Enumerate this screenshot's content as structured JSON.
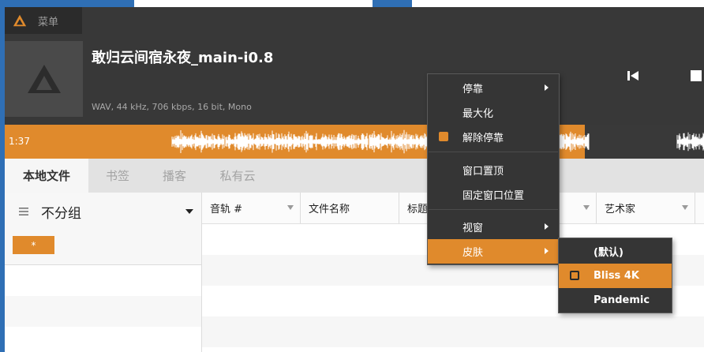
{
  "app": {
    "menu_label": "菜单",
    "track_title": "敢归云间宿永夜_main-i0.8",
    "track_info": "WAV, 44 kHz, 706 kbps, 16 bit, Mono",
    "elapsed_time": "1:37",
    "playback_progress_fraction": 0.83,
    "accent_color": "#e08a2c"
  },
  "tabs": [
    {
      "label": "本地文件",
      "active": true
    },
    {
      "label": "书签",
      "active": false
    },
    {
      "label": "播客",
      "active": false
    },
    {
      "label": "私有云",
      "active": false
    }
  ],
  "left_pane": {
    "group_label": "不分组",
    "filter_button": "*"
  },
  "table": {
    "columns": [
      "音轨 #",
      "文件名称",
      "标题",
      "",
      "艺术家"
    ]
  },
  "context_menu": {
    "items": [
      {
        "label": "停靠",
        "submenu": true
      },
      {
        "label": "最大化"
      },
      {
        "label": "解除停靠",
        "checked": true
      },
      {
        "label": "窗口置顶"
      },
      {
        "label": "固定窗口位置"
      },
      {
        "label": "视窗",
        "submenu": true
      },
      {
        "label": "皮肤",
        "submenu": true,
        "highlighted": true
      }
    ]
  },
  "skin_submenu": {
    "items": [
      {
        "label": "(默认)"
      },
      {
        "label": "Bliss 4K",
        "checked": true,
        "highlighted": true
      },
      {
        "label": "Pandemic"
      }
    ]
  }
}
